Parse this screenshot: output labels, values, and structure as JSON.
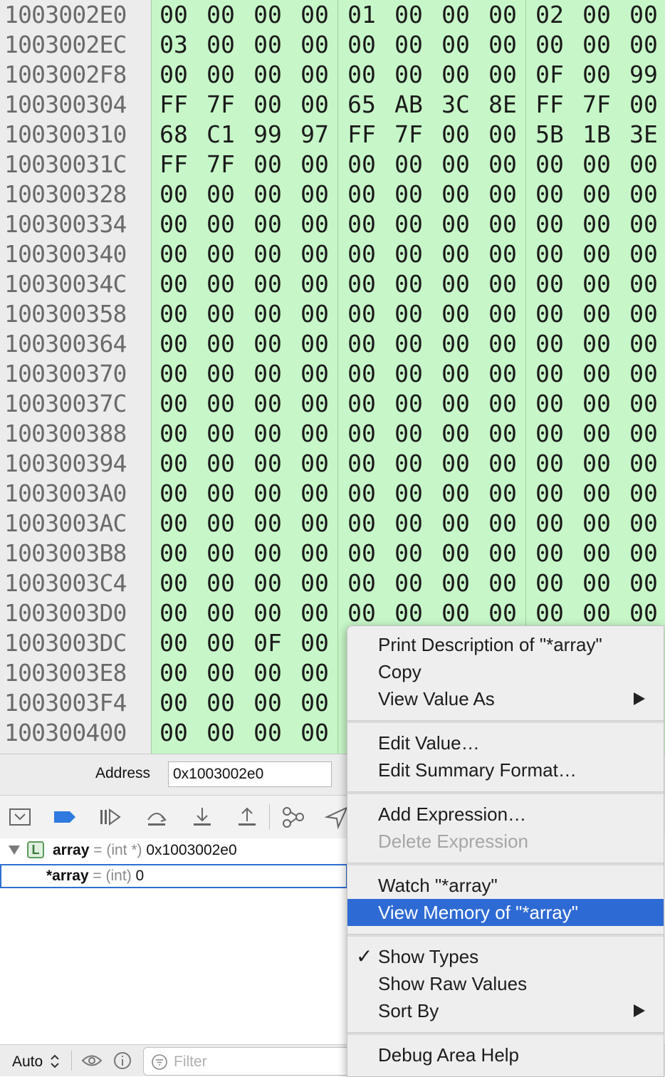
{
  "memory": {
    "rows": [
      {
        "address": "1003002E0",
        "bytes": [
          "00",
          "00",
          "00",
          "00",
          "01",
          "00",
          "00",
          "00",
          "02",
          "00",
          "00"
        ]
      },
      {
        "address": "1003002EC",
        "bytes": [
          "03",
          "00",
          "00",
          "00",
          "00",
          "00",
          "00",
          "00",
          "00",
          "00",
          "00"
        ]
      },
      {
        "address": "1003002F8",
        "bytes": [
          "00",
          "00",
          "00",
          "00",
          "00",
          "00",
          "00",
          "00",
          "0F",
          "00",
          "99"
        ]
      },
      {
        "address": "100300304",
        "bytes": [
          "FF",
          "7F",
          "00",
          "00",
          "65",
          "AB",
          "3C",
          "8E",
          "FF",
          "7F",
          "00"
        ]
      },
      {
        "address": "100300310",
        "bytes": [
          "68",
          "C1",
          "99",
          "97",
          "FF",
          "7F",
          "00",
          "00",
          "5B",
          "1B",
          "3E"
        ]
      },
      {
        "address": "10030031C",
        "bytes": [
          "FF",
          "7F",
          "00",
          "00",
          "00",
          "00",
          "00",
          "00",
          "00",
          "00",
          "00"
        ]
      },
      {
        "address": "100300328",
        "bytes": [
          "00",
          "00",
          "00",
          "00",
          "00",
          "00",
          "00",
          "00",
          "00",
          "00",
          "00"
        ]
      },
      {
        "address": "100300334",
        "bytes": [
          "00",
          "00",
          "00",
          "00",
          "00",
          "00",
          "00",
          "00",
          "00",
          "00",
          "00"
        ]
      },
      {
        "address": "100300340",
        "bytes": [
          "00",
          "00",
          "00",
          "00",
          "00",
          "00",
          "00",
          "00",
          "00",
          "00",
          "00"
        ]
      },
      {
        "address": "10030034C",
        "bytes": [
          "00",
          "00",
          "00",
          "00",
          "00",
          "00",
          "00",
          "00",
          "00",
          "00",
          "00"
        ]
      },
      {
        "address": "100300358",
        "bytes": [
          "00",
          "00",
          "00",
          "00",
          "00",
          "00",
          "00",
          "00",
          "00",
          "00",
          "00"
        ]
      },
      {
        "address": "100300364",
        "bytes": [
          "00",
          "00",
          "00",
          "00",
          "00",
          "00",
          "00",
          "00",
          "00",
          "00",
          "00"
        ]
      },
      {
        "address": "100300370",
        "bytes": [
          "00",
          "00",
          "00",
          "00",
          "00",
          "00",
          "00",
          "00",
          "00",
          "00",
          "00"
        ]
      },
      {
        "address": "10030037C",
        "bytes": [
          "00",
          "00",
          "00",
          "00",
          "00",
          "00",
          "00",
          "00",
          "00",
          "00",
          "00"
        ]
      },
      {
        "address": "100300388",
        "bytes": [
          "00",
          "00",
          "00",
          "00",
          "00",
          "00",
          "00",
          "00",
          "00",
          "00",
          "00"
        ]
      },
      {
        "address": "100300394",
        "bytes": [
          "00",
          "00",
          "00",
          "00",
          "00",
          "00",
          "00",
          "00",
          "00",
          "00",
          "00"
        ]
      },
      {
        "address": "1003003A0",
        "bytes": [
          "00",
          "00",
          "00",
          "00",
          "00",
          "00",
          "00",
          "00",
          "00",
          "00",
          "00"
        ]
      },
      {
        "address": "1003003AC",
        "bytes": [
          "00",
          "00",
          "00",
          "00",
          "00",
          "00",
          "00",
          "00",
          "00",
          "00",
          "00"
        ]
      },
      {
        "address": "1003003B8",
        "bytes": [
          "00",
          "00",
          "00",
          "00",
          "00",
          "00",
          "00",
          "00",
          "00",
          "00",
          "00"
        ]
      },
      {
        "address": "1003003C4",
        "bytes": [
          "00",
          "00",
          "00",
          "00",
          "00",
          "00",
          "00",
          "00",
          "00",
          "00",
          "00"
        ]
      },
      {
        "address": "1003003D0",
        "bytes": [
          "00",
          "00",
          "00",
          "00",
          "00",
          "00",
          "00",
          "00",
          "00",
          "00",
          "00"
        ]
      },
      {
        "address": "1003003DC",
        "bytes": [
          "00",
          "00",
          "0F",
          "00"
        ]
      },
      {
        "address": "1003003E8",
        "bytes": [
          "00",
          "00",
          "00",
          "00"
        ]
      },
      {
        "address": "1003003F4",
        "bytes": [
          "00",
          "00",
          "00",
          "00"
        ]
      },
      {
        "address": "100300400",
        "bytes": [
          "00",
          "00",
          "00",
          "00"
        ]
      }
    ]
  },
  "address_bar": {
    "label": "Address",
    "value": "0x1003002e0"
  },
  "toolbar": {
    "icons": [
      "hide-debug-area-icon",
      "breakpoints-toggle-icon",
      "continue-icon",
      "step-over-icon",
      "step-into-icon",
      "step-out-icon",
      "debug-view-hierarchy-icon",
      "simulate-location-icon"
    ]
  },
  "variables": {
    "rows": [
      {
        "name": "array",
        "equals": "=",
        "type": "(int *)",
        "value": "0x1003002e0",
        "badge": "L"
      },
      {
        "name": "*array",
        "equals": "=",
        "type": "(int)",
        "value": "0"
      }
    ]
  },
  "bottom_bar": {
    "scope": "Auto",
    "filter_placeholder": "Filter"
  },
  "context_menu": {
    "items": [
      {
        "label": "Print Description of \"*array\""
      },
      {
        "label": "Copy"
      },
      {
        "label": "View Value As"
      },
      {
        "label": "Edit Value…"
      },
      {
        "label": "Edit Summary Format…"
      },
      {
        "label": "Add Expression…"
      },
      {
        "label": "Delete Expression"
      },
      {
        "label": "Watch \"*array\""
      },
      {
        "label": "View Memory of \"*array\""
      },
      {
        "label": "Show Types"
      },
      {
        "label": "Show Raw Values"
      },
      {
        "label": "Sort By"
      },
      {
        "label": "Debug Area Help"
      }
    ]
  },
  "colors": {
    "hex_background": "#c7f7c8",
    "address_background": "#ececec",
    "menu_highlight": "#2e6ad3",
    "selection_border": "#2e6fd2"
  }
}
